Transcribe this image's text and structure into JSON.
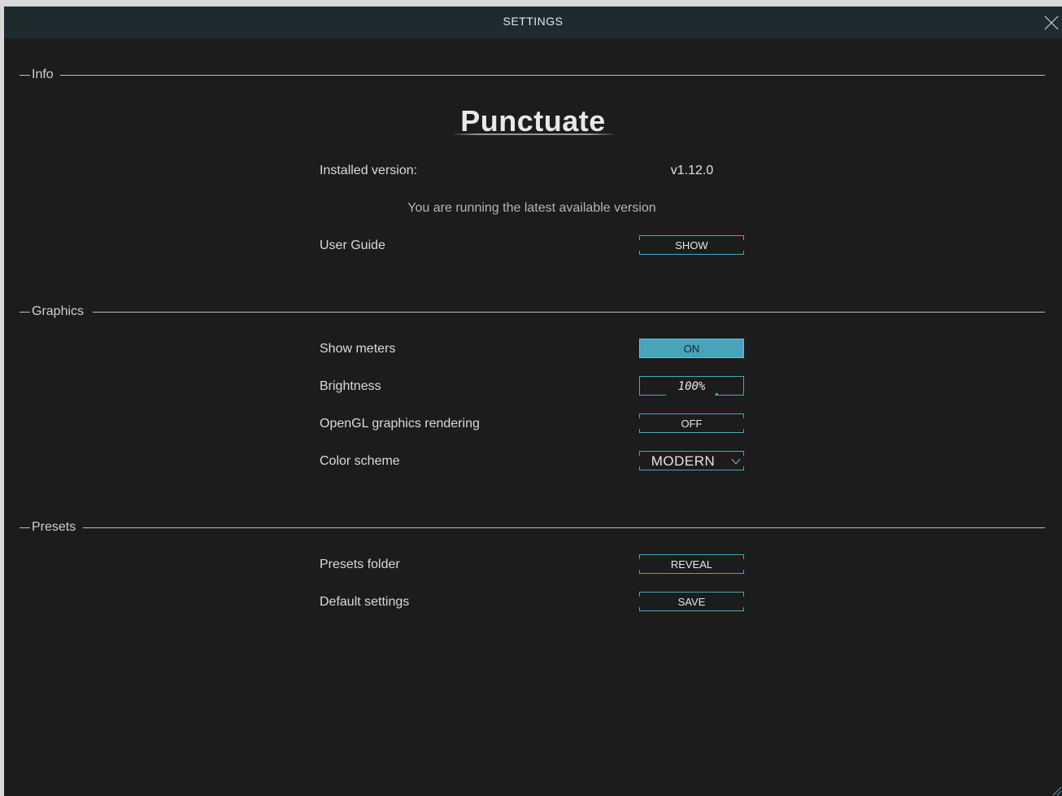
{
  "window": {
    "title": "SETTINGS"
  },
  "colors": {
    "accent": "#4aa6bf",
    "background": "#1c1c1c",
    "titlebar": "#1d2b2e"
  },
  "icons": {
    "close": "close-icon",
    "dropdown": "chevron-down-icon",
    "resize": "resize-grip-icon"
  },
  "info": {
    "section_label": "Info",
    "product_name": "Punctuate",
    "installed_version_label": "Installed version:",
    "installed_version_value": "v1.12.0",
    "update_status": "You are running the latest available version",
    "user_guide_label": "User Guide",
    "user_guide_button": "SHOW"
  },
  "graphics": {
    "section_label": "Graphics",
    "show_meters_label": "Show meters",
    "show_meters_value": "ON",
    "brightness_label": "Brightness",
    "brightness_value": "100%",
    "opengl_label": "OpenGL graphics rendering",
    "opengl_value": "OFF",
    "color_scheme_label": "Color scheme",
    "color_scheme_value": "MODERN"
  },
  "presets": {
    "section_label": "Presets",
    "presets_folder_label": "Presets folder",
    "presets_folder_button": "REVEAL",
    "default_settings_label": "Default settings",
    "default_settings_button": "SAVE"
  }
}
